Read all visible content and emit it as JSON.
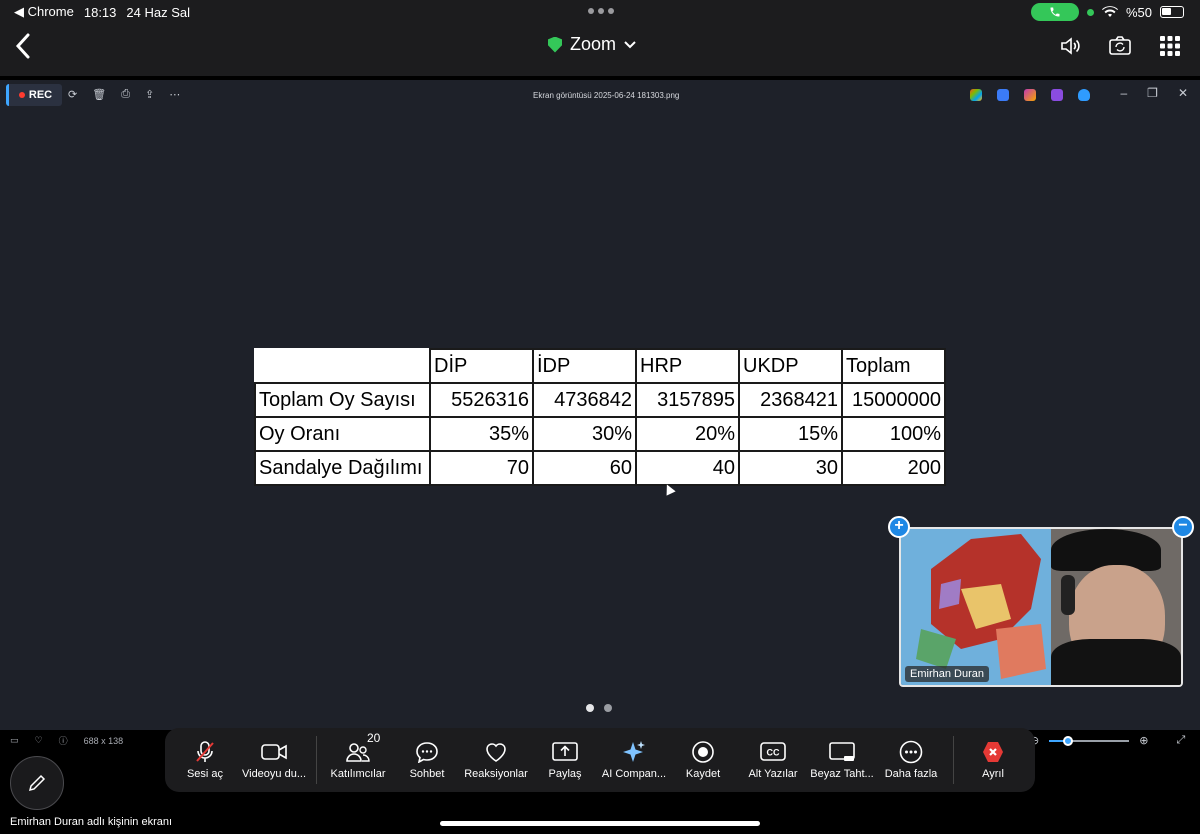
{
  "status_bar": {
    "back_app": "◀ Chrome",
    "time": "18:13",
    "date": "24 Haz Sal",
    "battery": "%50"
  },
  "header": {
    "title": "Zoom"
  },
  "viewer": {
    "rec_label": "REC",
    "file_name": "Ekran görüntüsü 2025-06-24 181303.png",
    "image_size": "688 x 138"
  },
  "table": {
    "headers": [
      "DİP",
      "İDP",
      "HRP",
      "UKDP",
      "Toplam"
    ],
    "rows": [
      {
        "label": "Toplam Oy Sayısı",
        "values": [
          "5526316",
          "4736842",
          "3157895",
          "2368421",
          "15000000"
        ]
      },
      {
        "label": "Oy Oranı",
        "values": [
          "35%",
          "30%",
          "20%",
          "15%",
          "100%"
        ]
      },
      {
        "label": "Sandalye Dağılımı",
        "values": [
          "70",
          "60",
          "40",
          "30",
          "200"
        ]
      }
    ]
  },
  "video": {
    "participant_name": "Emirhan Duran"
  },
  "controls": {
    "mute": "Sesi aç",
    "video": "Videoyu du...",
    "participants": "Katılımcılar",
    "participants_count": "20",
    "chat": "Sohbet",
    "reactions": "Reaksiyonlar",
    "share": "Paylaş",
    "ai": "AI Compan...",
    "record": "Kaydet",
    "captions": "Alt Yazılar",
    "whiteboard": "Beyaz Taht...",
    "more": "Daha fazla",
    "leave": "Ayrıl"
  },
  "share_caption": "Emirhan Duran adlı kişinin ekranı",
  "colors": {
    "accent_blue": "#1e88e5",
    "call_green": "#34c759",
    "leave_red": "#e53935",
    "share_bg": "#1e2129"
  }
}
